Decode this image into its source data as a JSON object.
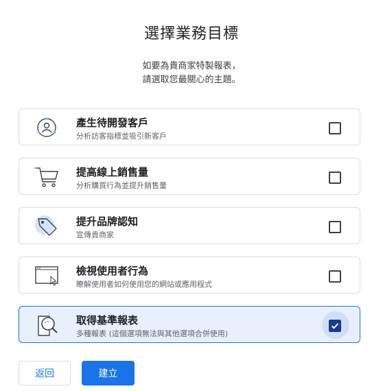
{
  "header": {
    "title": "選擇業務目標",
    "subtitle_line1": "如要為貴商家特製報表，",
    "subtitle_line2": "請選取您最關心的主題。"
  },
  "options": [
    {
      "title": "產生待開發客戶",
      "desc": "分析訪客指標並吸引新客戶",
      "icon": "person-target-icon",
      "checked": false
    },
    {
      "title": "提高線上銷售量",
      "desc": "分析購買行為並提升銷售量",
      "icon": "shopping-cart-icon",
      "checked": false
    },
    {
      "title": "提升品牌認知",
      "desc": "宣傳貴商家",
      "icon": "price-tag-icon",
      "checked": false
    },
    {
      "title": "檢視使用者行為",
      "desc": "瞭解使用者如何使用您的網站或應用程式",
      "icon": "browser-window-cursor-icon",
      "checked": false
    },
    {
      "title": "取得基準報表",
      "desc": "多種報表 (這個選項無法與其他選項合併使用)",
      "icon": "document-magnifier-icon",
      "checked": true
    }
  ],
  "buttons": {
    "back_label": "返回",
    "create_label": "建立"
  },
  "colors": {
    "accent": "#1a73e8",
    "selected_bg": "#e8f0fe",
    "checkbox_checked": "#1a3b8f"
  }
}
